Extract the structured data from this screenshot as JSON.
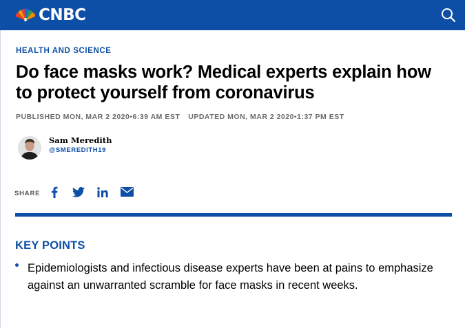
{
  "header": {
    "brand": "CNBC",
    "search_icon": "search-icon",
    "background_color": "#0d4fa6"
  },
  "article": {
    "section": "HEALTH AND SCIENCE",
    "headline": "Do face masks work? Medical experts explain how to protect yourself from coronavirus",
    "published_label": "PUBLISHED MON, MAR 2 2020•6:39 AM EST",
    "updated_label": "UPDATED MON, MAR 2 2020•1:37 PM EST",
    "author": {
      "name": "Sam Meredith",
      "handle": "@SMEREDITH19"
    }
  },
  "share": {
    "label": "SHARE",
    "icons": [
      "facebook-icon",
      "twitter-icon",
      "linkedin-icon",
      "email-icon"
    ]
  },
  "key_points": {
    "title": "KEY POINTS",
    "items": [
      "Epidemiologists and infectious disease experts have been at pains to emphasize against an unwarranted scramble for face masks in recent weeks."
    ]
  },
  "colors": {
    "accent": "#0d4fa6",
    "peacock": [
      "#f4a200",
      "#e8402b",
      "#8a3fa0",
      "#1a6fc4",
      "#2e9a47",
      "#f38b00"
    ]
  }
}
